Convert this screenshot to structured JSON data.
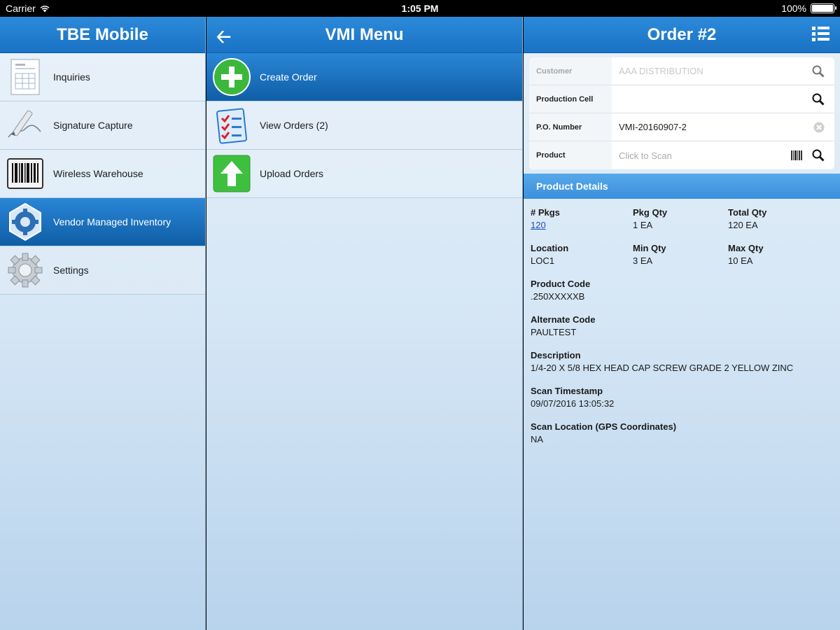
{
  "status": {
    "carrier": "Carrier",
    "time": "1:05 PM",
    "battery": "100%",
    "battery_level": 1.0
  },
  "left": {
    "title": "TBE Mobile",
    "items": [
      {
        "label": "Inquiries",
        "icon": "document-icon"
      },
      {
        "label": "Signature Capture",
        "icon": "signature-pen-icon"
      },
      {
        "label": "Wireless Warehouse",
        "icon": "barcode-icon"
      },
      {
        "label": "Vendor Managed Inventory",
        "icon": "vmi-gear-icon",
        "selected": true
      },
      {
        "label": "Settings",
        "icon": "gear-icon"
      }
    ]
  },
  "mid": {
    "title": "VMI Menu",
    "items": [
      {
        "label": "Create Order",
        "icon": "plus-circle-icon",
        "selected": true
      },
      {
        "label": "View Orders (2)",
        "icon": "checklist-icon"
      },
      {
        "label": "Upload Orders",
        "icon": "upload-arrow-icon"
      }
    ]
  },
  "right": {
    "title": "Order #2",
    "form": {
      "customer_label": "Customer",
      "customer_value": "AAA DISTRIBUTION",
      "production_cell_label": "Production Cell",
      "production_cell_value": "",
      "po_label": "P.O. Number",
      "po_value": "VMI-20160907-2",
      "product_label": "Product",
      "product_placeholder": "Click to Scan"
    },
    "section": "Product Details",
    "details": {
      "pkgs_label": "# Pkgs",
      "pkgs_value": "120",
      "pkg_qty_label": "Pkg Qty",
      "pkg_qty_value": "1 EA",
      "total_qty_label": "Total Qty",
      "total_qty_value": "120 EA",
      "location_label": "Location",
      "location_value": "LOC1",
      "min_qty_label": "Min Qty",
      "min_qty_value": "3 EA",
      "max_qty_label": "Max Qty",
      "max_qty_value": "10 EA",
      "product_code_label": "Product Code",
      "product_code_value": ".250XXXXXB",
      "alt_code_label": "Alternate Code",
      "alt_code_value": "PAULTEST",
      "description_label": "Description",
      "description_value": "1/4-20 X 5/8 HEX HEAD CAP SCREW GRADE 2 YELLOW ZINC",
      "timestamp_label": "Scan Timestamp",
      "timestamp_value": "09/07/2016 13:05:32",
      "gps_label": "Scan Location (GPS Coordinates)",
      "gps_value": "NA"
    }
  }
}
